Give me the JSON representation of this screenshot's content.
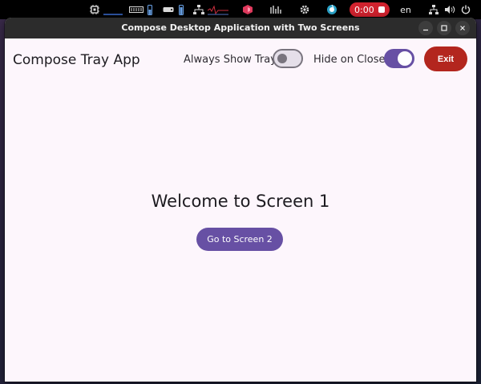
{
  "top_panel": {
    "icons": [
      "cpu-icon",
      "memory-graph-icon",
      "storage-icon",
      "drive-icon",
      "battery-icon",
      "network-graph-icon",
      "app-icon",
      "stats-icon",
      "gear-icon",
      "browser-icon"
    ],
    "recording": {
      "time": "0:00",
      "color": "#d0222e"
    },
    "language": "en",
    "system_icons": [
      "network-icon",
      "volume-icon",
      "power-icon"
    ]
  },
  "window": {
    "title": "Compose Desktop Application with Two Screens",
    "controls": [
      "minimize-icon",
      "maximize-icon",
      "close-icon"
    ],
    "background": "#fdf6fc"
  },
  "header": {
    "app_title": "Compose Tray App",
    "always_show_tray": {
      "label": "Always Show Tray",
      "checked": false
    },
    "hide_on_close": {
      "label": "Hide on Close",
      "checked": true
    },
    "exit_label": "Exit",
    "exit_color": "#b3261e"
  },
  "screen": {
    "welcome_text": "Welcome to Screen 1",
    "goto_button_label": "Go to Screen 2",
    "accent_color": "#6750a4"
  }
}
